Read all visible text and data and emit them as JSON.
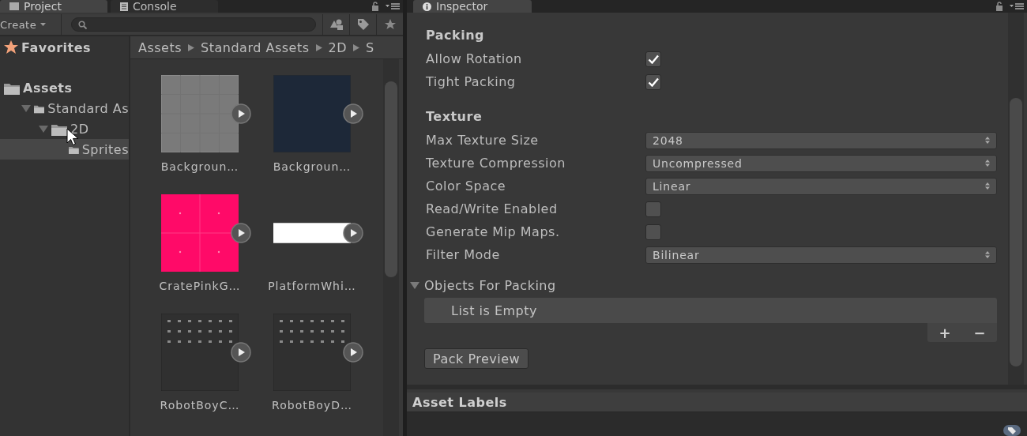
{
  "project_panel": {
    "tabs": [
      {
        "label": "Project",
        "selected": true
      },
      {
        "label": "Console",
        "selected": false
      }
    ],
    "toolbar": {
      "create": "Create"
    },
    "tree": [
      {
        "label": "Favorites",
        "kind": "favorites"
      },
      {
        "label": "Assets",
        "kind": "root",
        "children": [
          {
            "label": "Standard As",
            "expanded": true,
            "selected": false,
            "children": [
              {
                "label": "2D",
                "expanded": true,
                "selected": false,
                "children": [
                  {
                    "label": "Sprites",
                    "selected": true
                  }
                ]
              }
            ]
          }
        ]
      }
    ],
    "breadcrumb": [
      "Assets",
      "Standard Assets",
      "2D",
      "S"
    ],
    "assets": [
      {
        "name": "Backgroun…",
        "kind": "grid"
      },
      {
        "name": "Backgroun…",
        "kind": "dark"
      },
      {
        "name": "CratePinkG…",
        "kind": "pink"
      },
      {
        "name": "PlatformWhi…",
        "kind": "bar"
      },
      {
        "name": "RobotBoyC…",
        "kind": "sheet"
      },
      {
        "name": "RobotBoyD…",
        "kind": "sheet"
      }
    ]
  },
  "inspector": {
    "tab": {
      "label": "Inspector",
      "selected": true
    },
    "sections": [
      {
        "title": "Packing",
        "rows": [
          {
            "label": "Allow Rotation",
            "kind": "checkbox",
            "checked": true
          },
          {
            "label": "Tight Packing",
            "kind": "checkbox",
            "checked": true
          }
        ]
      },
      {
        "title": "Texture",
        "rows": [
          {
            "label": "Max Texture Size",
            "kind": "dropdown",
            "value": "2048"
          },
          {
            "label": "Texture Compression",
            "kind": "dropdown",
            "value": "Uncompressed"
          },
          {
            "label": "Color Space",
            "kind": "dropdown",
            "value": "Linear"
          },
          {
            "label": "Read/Write Enabled",
            "kind": "checkbox",
            "checked": false
          },
          {
            "label": "Generate Mip Maps.",
            "kind": "checkbox",
            "checked": false
          },
          {
            "label": "Filter Mode",
            "kind": "dropdown",
            "value": "Bilinear"
          }
        ]
      }
    ],
    "objects_for_packing": {
      "label": "Objects For Packing",
      "expanded": true,
      "empty_text": "List is Empty",
      "add": "+",
      "remove": "−"
    },
    "pack_preview": "Pack Preview"
  },
  "asset_labels": {
    "title": "Asset Labels"
  }
}
